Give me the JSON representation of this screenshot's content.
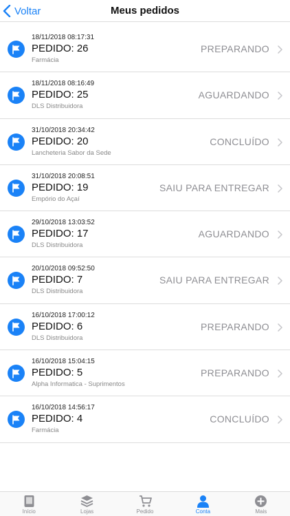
{
  "navbar": {
    "back_label": "Voltar",
    "title": "Meus pedidos"
  },
  "colors": {
    "accent": "#1a82f7",
    "status_text": "#8e8e93",
    "divider": "#dcdcdc"
  },
  "orders": [
    {
      "date": "18/11/2018 08:17:31",
      "number": "PEDIDO: 26",
      "store": "Farmácia",
      "status": "PREPARANDO",
      "icon": "flag-icon"
    },
    {
      "date": "18/11/2018 08:16:49",
      "number": "PEDIDO: 25",
      "store": "DLS Distribuidora",
      "status": "AGUARDANDO",
      "icon": "flag-icon"
    },
    {
      "date": "31/10/2018 20:34:42",
      "number": "PEDIDO: 20",
      "store": "Lancheteria Sabor da Sede",
      "status": "CONCLUÍDO",
      "icon": "flag-icon"
    },
    {
      "date": "31/10/2018 20:08:51",
      "number": "PEDIDO: 19",
      "store": "Empório do Açaí",
      "status": "SAIU PARA ENTREGAR",
      "icon": "flag-icon"
    },
    {
      "date": "29/10/2018 13:03:52",
      "number": "PEDIDO: 17",
      "store": "DLS Distribuidora",
      "status": "AGUARDANDO",
      "icon": "flag-icon"
    },
    {
      "date": "20/10/2018 09:52:50",
      "number": "PEDIDO: 7",
      "store": "DLS Distribuidora",
      "status": "SAIU PARA ENTREGAR",
      "icon": "flag-icon"
    },
    {
      "date": "16/10/2018 17:00:12",
      "number": "PEDIDO: 6",
      "store": "DLS Distribuidora",
      "status": "PREPARANDO",
      "icon": "flag-icon"
    },
    {
      "date": "16/10/2018 15:04:15",
      "number": "PEDIDO: 5",
      "store": "Alpha Informatica - Suprimentos",
      "status": "PREPARANDO",
      "icon": "flag-icon"
    },
    {
      "date": "16/10/2018 14:56:17",
      "number": "PEDIDO: 4",
      "store": "Farmácia",
      "status": "CONCLUÍDO",
      "icon": "flag-icon"
    }
  ],
  "tabbar": {
    "tabs": [
      {
        "label": "Início",
        "icon": "home-icon",
        "active": false
      },
      {
        "label": "Lojas",
        "icon": "stores-icon",
        "active": false
      },
      {
        "label": "Pedido",
        "icon": "cart-icon",
        "active": false
      },
      {
        "label": "Conta",
        "icon": "person-icon",
        "active": true
      },
      {
        "label": "Mais",
        "icon": "plus-circle-icon",
        "active": false
      }
    ]
  }
}
